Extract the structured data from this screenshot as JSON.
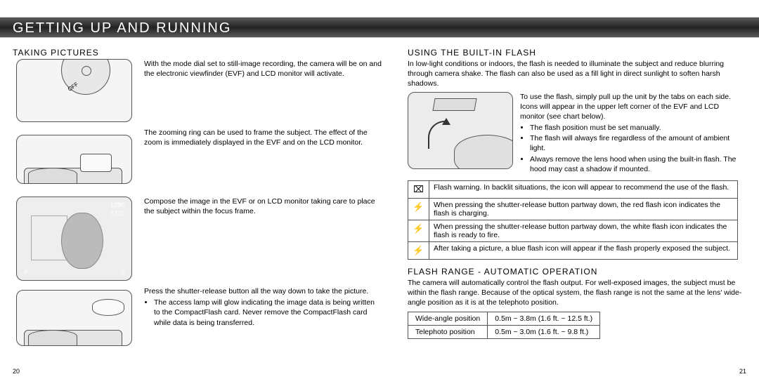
{
  "banner": "GETTING UP AND RUNNING",
  "left": {
    "heading": "TAKING PICTURES",
    "rows": [
      {
        "text": "With the mode dial set to still-image recording, the camera will be on and the electronic viewfinder (EVF) and LCD monitor will activate."
      },
      {
        "text": "The zooming ring can be used to frame the subject. The effect of the zoom is immediately displayed in the EVF and on the LCD monitor."
      },
      {
        "text": "Compose the image in the EVF or on LCD monitor taking care to place the subject within the focus frame."
      },
      {
        "text": "Press the shutter-release button all the way down to take the picture.",
        "bullets": [
          "The access lamp will glow indicating the image data is being written to the CompactFlash card. Never remove the CompactFlash card while data is being transferred."
        ]
      }
    ],
    "evf_tags": {
      "tl": "1280",
      "tl2": "STD",
      "bl": "P",
      "br": "9"
    },
    "dial_off": "OFF",
    "pagenum": "20"
  },
  "right": {
    "heading1": "USING THE BUILT-IN FLASH",
    "intro1": "In low-light conditions or indoors, the flash is needed to illuminate the subject and reduce blurring through camera shake. The flash can also be used as a fill light in direct sunlight to soften harsh shadows.",
    "flash_use_text": "To use the flash, simply pull up the unit by the tabs on each side. Icons will appear in the upper left corner of the EVF and LCD monitor (see chart below).",
    "flash_use_bullets": [
      "The flash position must be set manually.",
      "The flash will always fire regardless of the amount of ambient light.",
      "Always remove the lens hood when using the built-in flash. The hood may cast a shadow if mounted."
    ],
    "flash_table": [
      {
        "icon": "⌧",
        "text": "Flash warning. In backlit situations, the icon will appear to recommend the use of the flash."
      },
      {
        "icon": "⚡",
        "text": "When pressing the shutter-release button partway down, the red flash icon indicates the flash is charging."
      },
      {
        "icon": "⚡",
        "text": "When pressing the shutter-release button partway down, the white flash icon indicates the flash is ready to fire."
      },
      {
        "icon": "⚡",
        "text": "After taking a picture, a blue flash icon will appear if the flash properly exposed the subject."
      }
    ],
    "heading2": "FLASH RANGE - AUTOMATIC OPERATION",
    "intro2": "The camera will automatically control the flash output. For well-exposed images, the subject must be within the flash range. Because of the optical system, the flash range is not the same at the lens' wide-angle position as it is at the telephoto position.",
    "range_table": [
      {
        "pos": "Wide-angle position",
        "val": "0.5m ~ 3.8m (1.6 ft. ~ 12.5 ft.)"
      },
      {
        "pos": "Telephoto position",
        "val": "0.5m ~ 3.0m (1.6 ft. ~ 9.8 ft.)"
      }
    ],
    "pagenum": "21"
  }
}
